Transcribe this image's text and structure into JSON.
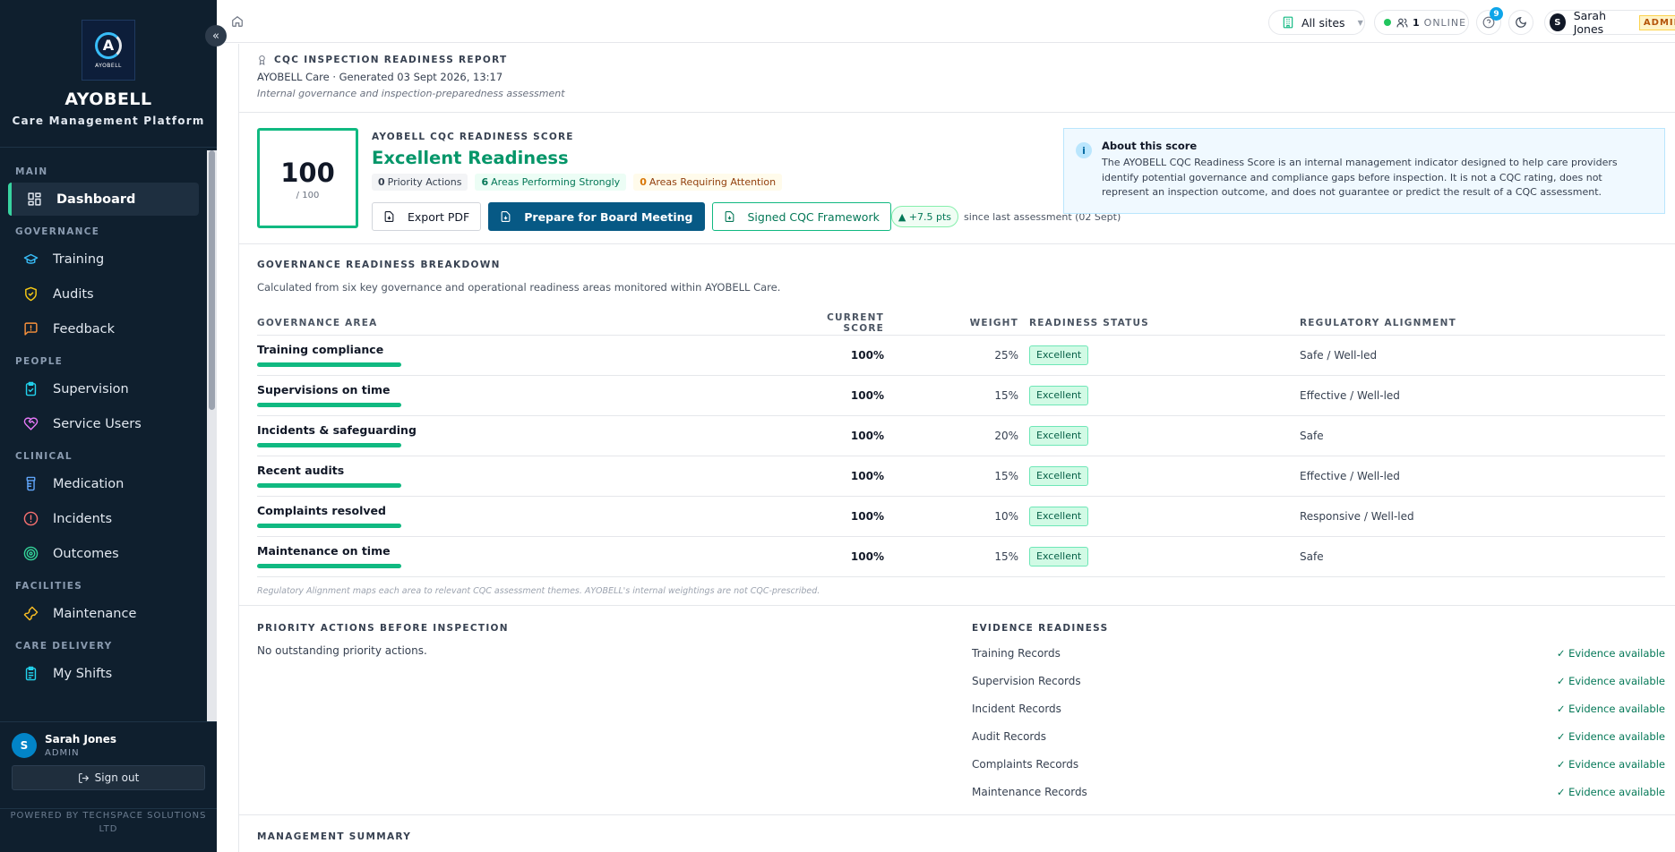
{
  "sidebar": {
    "brand_name": "AYOBELL",
    "brand_sub": "Care Management Platform",
    "logo_text": "AYOBELL",
    "collapse_icon": "«",
    "sections": [
      {
        "label": "MAIN",
        "items": [
          {
            "label": "Dashboard",
            "icon": "grid-icon",
            "active": true
          }
        ]
      },
      {
        "label": "GOVERNANCE",
        "items": [
          {
            "label": "Training",
            "icon": "graduation-cap-icon"
          },
          {
            "label": "Audits",
            "icon": "shield-check-icon"
          },
          {
            "label": "Feedback",
            "icon": "message-alert-icon"
          }
        ]
      },
      {
        "label": "PEOPLE",
        "items": [
          {
            "label": "Supervision",
            "icon": "clipboard-check-icon"
          },
          {
            "label": "Service Users",
            "icon": "heart-handshake-icon"
          }
        ]
      },
      {
        "label": "CLINICAL",
        "items": [
          {
            "label": "Medication",
            "icon": "pill-bottle-icon"
          },
          {
            "label": "Incidents",
            "icon": "alert-circle-icon"
          },
          {
            "label": "Outcomes",
            "icon": "target-icon"
          }
        ]
      },
      {
        "label": "FACILITIES",
        "items": [
          {
            "label": "Maintenance",
            "icon": "wrench-icon"
          }
        ]
      },
      {
        "label": "CARE DELIVERY",
        "items": [
          {
            "label": "My Shifts",
            "icon": "clipboard-list-icon"
          }
        ]
      }
    ],
    "user": {
      "initial": "S",
      "name": "Sarah Jones",
      "role": "ADMIN"
    },
    "signout_label": "Sign out",
    "powered": "POWERED BY TECHSPACE SOLUTIONS LTD"
  },
  "topbar": {
    "sites_label": "All sites",
    "online_count": "1",
    "online_label": "ONLINE",
    "help_badge": "9",
    "user_initial": "S",
    "user_name": "Sarah Jones",
    "user_role": "ADMIN"
  },
  "report": {
    "title": "CQC INSPECTION READINESS REPORT",
    "generated": "AYOBELL Care · Generated 03 Sept 2026, 13:17",
    "description": "Internal governance and inspection-preparedness assessment"
  },
  "score": {
    "value": "100",
    "denominator": "/ 100",
    "label": "AYOBELL CQC READINESS SCORE",
    "rating": "Excellent Readiness",
    "priority_count": "0",
    "priority_label": "Priority Actions",
    "strong_count": "6",
    "strong_label": "Areas Performing Strongly",
    "attention_count": "0",
    "attention_label": "Areas Requiring Attention",
    "export_label": "Export PDF",
    "board_label": "Prepare for Board Meeting",
    "framework_label": "Signed CQC Framework",
    "delta": "▲ +7.5 pts",
    "delta_note": "since last assessment (02 Sept)"
  },
  "about": {
    "title": "About this score",
    "text": "The AYOBELL CQC Readiness Score is an internal management indicator designed to help care providers identify potential governance and compliance gaps before inspection. It is not a CQC rating, does not represent an inspection outcome, and does not guarantee or predict the result of a CQC assessment."
  },
  "breakdown": {
    "title": "GOVERNANCE READINESS BREAKDOWN",
    "description": "Calculated from six key governance and operational readiness areas monitored within AYOBELL Care.",
    "headers": {
      "area": "GOVERNANCE AREA",
      "score": "CURRENT SCORE",
      "weight": "WEIGHT",
      "status": "READINESS STATUS",
      "alignment": "REGULATORY ALIGNMENT"
    },
    "rows": [
      {
        "area": "Training compliance",
        "score": "100%",
        "weight": "25%",
        "status": "Excellent",
        "alignment": "Safe / Well-led",
        "progress": 1.0
      },
      {
        "area": "Supervisions on time",
        "score": "100%",
        "weight": "15%",
        "status": "Excellent",
        "alignment": "Effective / Well-led",
        "progress": 1.0
      },
      {
        "area": "Incidents & safeguarding",
        "score": "100%",
        "weight": "20%",
        "status": "Excellent",
        "alignment": "Safe",
        "progress": 1.0
      },
      {
        "area": "Recent audits",
        "score": "100%",
        "weight": "15%",
        "status": "Excellent",
        "alignment": "Effective / Well-led",
        "progress": 1.0
      },
      {
        "area": "Complaints resolved",
        "score": "100%",
        "weight": "10%",
        "status": "Excellent",
        "alignment": "Responsive / Well-led",
        "progress": 1.0
      },
      {
        "area": "Maintenance on time",
        "score": "100%",
        "weight": "15%",
        "status": "Excellent",
        "alignment": "Safe",
        "progress": 1.0
      }
    ],
    "footnote": "Regulatory Alignment maps each area to relevant CQC assessment themes. AYOBELL's internal weightings are not CQC-prescribed."
  },
  "priority": {
    "title": "PRIORITY ACTIONS BEFORE INSPECTION",
    "text": "No outstanding priority actions."
  },
  "evidence": {
    "title": "EVIDENCE READINESS",
    "rows": [
      {
        "label": "Training Records",
        "status": "✓ Evidence available"
      },
      {
        "label": "Supervision Records",
        "status": "✓ Evidence available"
      },
      {
        "label": "Incident Records",
        "status": "✓ Evidence available"
      },
      {
        "label": "Audit Records",
        "status": "✓ Evidence available"
      },
      {
        "label": "Complaints Records",
        "status": "✓ Evidence available"
      },
      {
        "label": "Maintenance Records",
        "status": "✓ Evidence available"
      }
    ]
  },
  "management": {
    "title": "MANAGEMENT SUMMARY"
  },
  "colors": {
    "sidebar_bg": "#0f1f2e",
    "accent_green": "#10b981",
    "primary_blue": "#075985",
    "active_marker": "#38d3a0"
  }
}
